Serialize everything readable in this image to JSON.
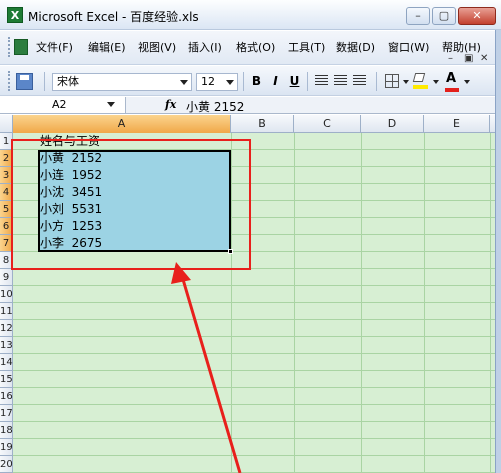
{
  "window": {
    "title": "Microsoft Excel - 百度经验.xls",
    "icon": "excel-icon",
    "buttons": [
      "minimize",
      "maximize",
      "close"
    ]
  },
  "menu": {
    "items": [
      {
        "label": "文件(F)"
      },
      {
        "label": "编辑(E)"
      },
      {
        "label": "视图(V)"
      },
      {
        "label": "插入(I)"
      },
      {
        "label": "格式(O)"
      },
      {
        "label": "工具(T)"
      },
      {
        "label": "数据(D)"
      },
      {
        "label": "窗口(W)"
      },
      {
        "label": "帮助(H)"
      }
    ]
  },
  "toolbar": {
    "font_name": "宋体",
    "font_size": "12",
    "bold": "B",
    "italic": "I",
    "underline": "U",
    "font_color_letter": "A",
    "fill_color": "#ffea00",
    "font_color": "#e3201b"
  },
  "formula_bar": {
    "name_box": "A2",
    "fx_label": "fx",
    "content": "小黄  2152"
  },
  "sheet": {
    "columns": [
      "A",
      "B",
      "C",
      "D",
      "E"
    ],
    "selected_column": "A",
    "rows": [
      "1",
      "2",
      "3",
      "4",
      "5",
      "6",
      "7",
      "8",
      "9",
      "10",
      "11",
      "12",
      "13",
      "14",
      "15",
      "16",
      "17",
      "18",
      "19",
      "20"
    ],
    "selected_rows": [
      "2",
      "3",
      "4",
      "5",
      "6",
      "7"
    ],
    "cells": [
      {
        "ref": "A1",
        "text": "姓名与工资"
      },
      {
        "ref": "A2",
        "text": "小黄  2152"
      },
      {
        "ref": "A3",
        "text": "小连  1952"
      },
      {
        "ref": "A4",
        "text": "小沈  3451"
      },
      {
        "ref": "A5",
        "text": "小刘  5531"
      },
      {
        "ref": "A6",
        "text": "小方  1253"
      },
      {
        "ref": "A7",
        "text": "小李  2675"
      }
    ],
    "selection": "A2:A7",
    "grid_color": "#d7efd3",
    "selection_color": "#9cd3e4"
  },
  "annotation": {
    "highlight_color": "#e8201c"
  }
}
